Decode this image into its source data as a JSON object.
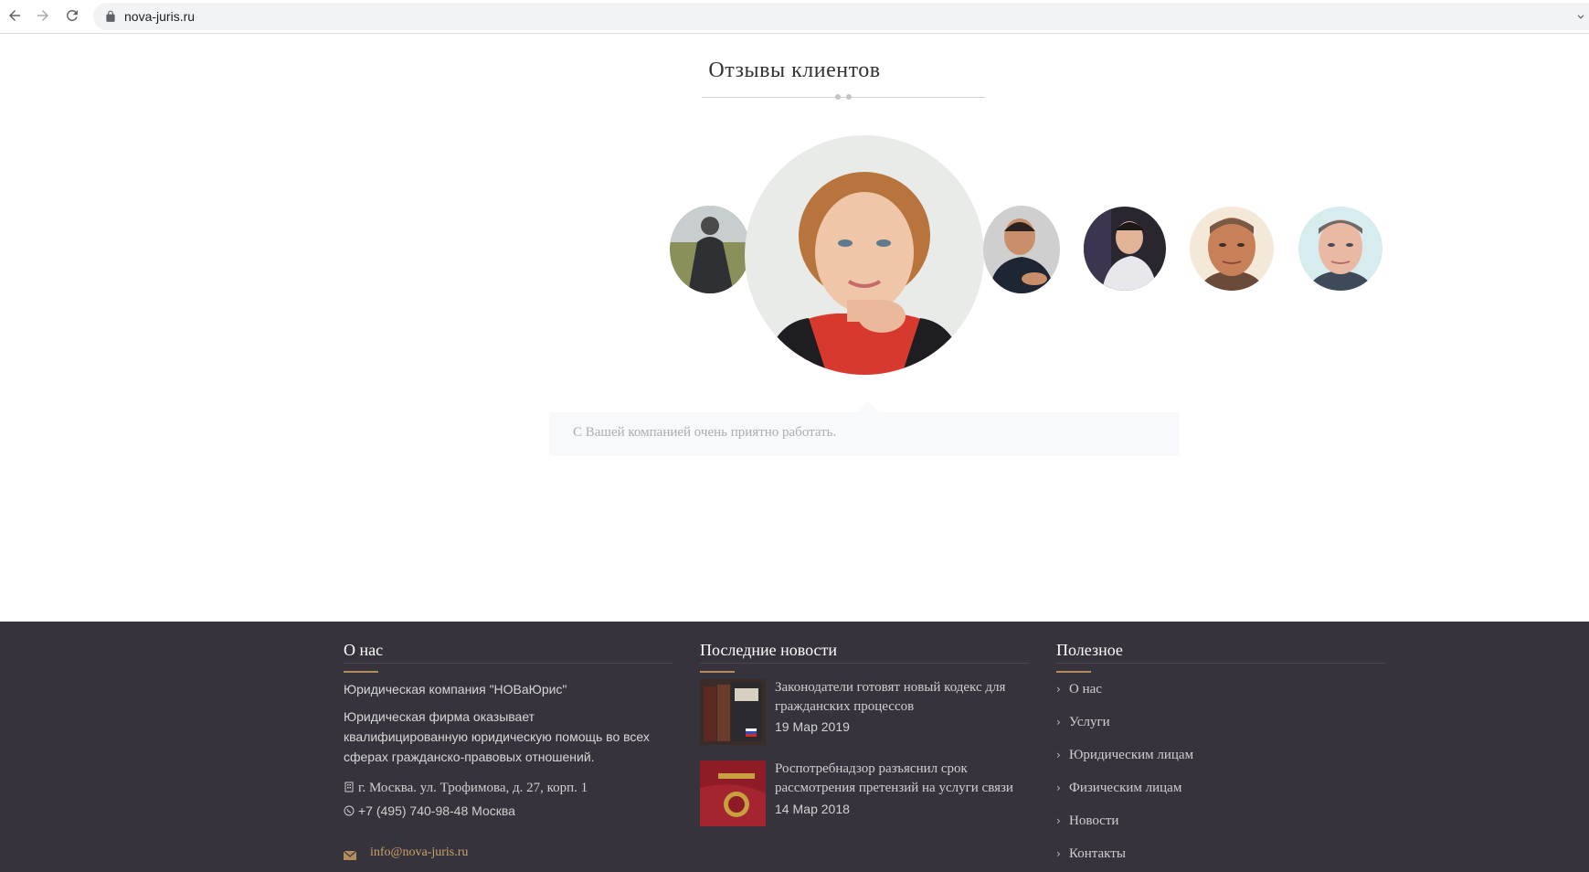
{
  "browser": {
    "url": "nova-juris.ru",
    "icons": [
      "back-arrow-icon",
      "forward-arrow-icon",
      "reload-icon",
      "lock-icon",
      "chevron-down-icon"
    ]
  },
  "testimonials": {
    "title": "Отзывы клиентов",
    "active_quote": "С Вашей компанией очень приятно работать.",
    "avatars": [
      "client-1",
      "client-2-active",
      "client-3",
      "client-4",
      "client-5",
      "client-6"
    ]
  },
  "footer": {
    "about": {
      "heading": "О нас",
      "company_name": "Юридическая компания \"НОВаЮрис\"",
      "description_lines": [
        "Юридическая фирма оказывает",
        "квалифицированную юридическую помощь во всех",
        "сферах гражданско-правовых отношений."
      ],
      "address": "г. Москва. ул. Трофимова, д. 27, корп. 1",
      "phone": "+7 (495) 740-98-48 Москва",
      "email": "info@nova-juris.ru"
    },
    "news": {
      "heading": "Последние новости",
      "items": [
        {
          "title_lines": [
            "Законодатели готовят новый кодекс для",
            "гражданских процессов"
          ],
          "date": "19 Мар 2019"
        },
        {
          "title_lines": [
            "Роспотребнадзор разъяснил срок",
            "рассмотрения претензий на услуги связи"
          ],
          "date": "14 Мар 2018"
        }
      ]
    },
    "useful": {
      "heading": "Полезное",
      "links": [
        "О нас",
        "Услуги",
        "Юридическим лицам",
        "Физическим лицам",
        "Новости",
        "Контакты"
      ]
    }
  },
  "colors": {
    "footer_bg": "#37333c",
    "accent": "#b38e5d",
    "email": "#c9a36b"
  }
}
